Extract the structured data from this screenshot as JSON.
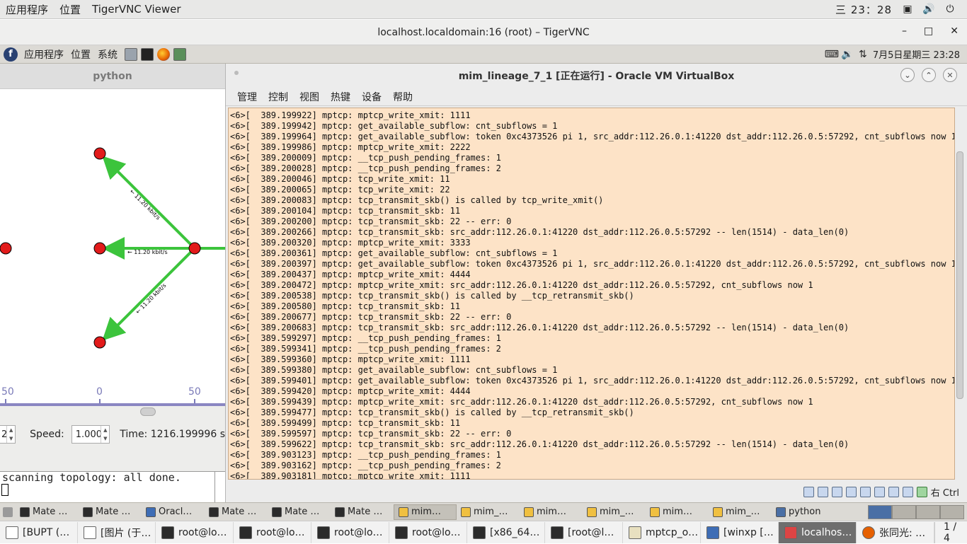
{
  "outer_top": {
    "apps_label": "应用程序",
    "places_label": "位置",
    "app_name": "TigerVNC Viewer",
    "clock": "三 23：28"
  },
  "vnc_window": {
    "title": "localhost.localdomain:16 (root) – TigerVNC",
    "minimize": "–",
    "maximize": "□",
    "close": "✕"
  },
  "inner_panel": {
    "apps_label": "应用程序",
    "places_label": "位置",
    "system_label": "系统",
    "datetime": "7月5日星期三 23:28"
  },
  "python_window": {
    "title": "python",
    "axis_labels": [
      "50",
      "0",
      "50"
    ],
    "links": [
      {
        "label": "← 11.20 kbit/s"
      },
      {
        "label": "← 11.20 kbit/s"
      },
      {
        "label": "← 11.20 kbit/s"
      }
    ],
    "speed_label": "Speed:",
    "speed_value": "1.000",
    "time_text": "Time: 1216.199996 s",
    "left_spin_value": "2"
  },
  "terminal": {
    "line": "scanning topology: all done."
  },
  "vbox": {
    "title": "mim_lineage_7_1 [正在运行] - Oracle VM VirtualBox",
    "menu": [
      "管理",
      "控制",
      "视图",
      "热键",
      "设备",
      "帮助"
    ],
    "host_key": "右 Ctrl",
    "console_lines": [
      "<6>[  389.199922] mptcp: mptcp_write_xmit: 1111",
      "<6>[  389.199942] mptcp: get_available_subflow: cnt_subflows = 1",
      "<6>[  389.199964] mptcp: get_available_subflow: token 0xc4373526 pi 1, src_addr:112.26.0.1:41220 dst_addr:112.26.0.5:57292, cnt_subflows now 1",
      "<6>[  389.199986] mptcp: mptcp_write_xmit: 2222",
      "<6>[  389.200009] mptcp: __tcp_push_pending_frames: 1",
      "<6>[  389.200028] mptcp: __tcp_push_pending_frames: 2",
      "<6>[  389.200046] mptcp: tcp_write_xmit: 11",
      "<6>[  389.200065] mptcp: tcp_write_xmit: 22",
      "<6>[  389.200083] mptcp: tcp_transmit_skb() is called by tcp_write_xmit()",
      "<6>[  389.200104] mptcp: tcp_transmit_skb: 11",
      "<6>[  389.200200] mptcp: tcp_transmit_skb: 22 -- err: 0",
      "<6>[  389.200266] mptcp: tcp_transmit_skb: src_addr:112.26.0.1:41220 dst_addr:112.26.0.5:57292 -- len(1514) - data_len(0)",
      "<6>[  389.200320] mptcp: mptcp_write_xmit: 3333",
      "<6>[  389.200361] mptcp: get_available_subflow: cnt_subflows = 1",
      "<6>[  389.200397] mptcp: get_available_subflow: token 0xc4373526 pi 1, src_addr:112.26.0.1:41220 dst_addr:112.26.0.5:57292, cnt_subflows now 1",
      "<6>[  389.200437] mptcp: mptcp_write_xmit: 4444",
      "<6>[  389.200472] mptcp: mptcp_write_xmit: src_addr:112.26.0.1:41220 dst_addr:112.26.0.5:57292, cnt_subflows now 1",
      "<6>[  389.200538] mptcp: tcp_transmit_skb() is called by __tcp_retransmit_skb()",
      "<6>[  389.200580] mptcp: tcp_transmit_skb: 11",
      "<6>[  389.200677] mptcp: tcp_transmit_skb: 22 -- err: 0",
      "<6>[  389.200683] mptcp: tcp_transmit_skb: src_addr:112.26.0.1:41220 dst_addr:112.26.0.5:57292 -- len(1514) - data_len(0)",
      "<6>[  389.599297] mptcp: __tcp_push_pending_frames: 1",
      "<6>[  389.599341] mptcp: __tcp_push_pending_frames: 2",
      "<6>[  389.599360] mptcp: mptcp_write_xmit: 1111",
      "<6>[  389.599380] mptcp: get_available_subflow: cnt_subflows = 1",
      "<6>[  389.599401] mptcp: get_available_subflow: token 0xc4373526 pi 1, src_addr:112.26.0.1:41220 dst_addr:112.26.0.5:57292, cnt_subflows now 1",
      "<6>[  389.599420] mptcp: mptcp_write_xmit: 4444",
      "<6>[  389.599439] mptcp: mptcp_write_xmit: src_addr:112.26.0.1:41220 dst_addr:112.26.0.5:57292, cnt_subflows now 1",
      "<6>[  389.599477] mptcp: tcp_transmit_skb() is called by __tcp_retransmit_skb()",
      "<6>[  389.599499] mptcp: tcp_transmit_skb: 11",
      "<6>[  389.599597] mptcp: tcp_transmit_skb: 22 -- err: 0",
      "<6>[  389.599622] mptcp: tcp_transmit_skb: src_addr:112.26.0.1:41220 dst_addr:112.26.0.5:57292 -- len(1514) - data_len(0)",
      "<6>[  389.903123] mptcp: __tcp_push_pending_frames: 1",
      "<6>[  389.903162] mptcp: __tcp_push_pending_frames: 2",
      "<6>[  389.903181] mptcp: mptcp_write_xmit: 1111"
    ]
  },
  "inner_taskbar": {
    "items": [
      {
        "label": "Mate …",
        "icon": "terminal-icon"
      },
      {
        "label": "Mate …",
        "icon": "terminal-icon"
      },
      {
        "label": "Oracl…",
        "icon": "virtualbox-icon"
      },
      {
        "label": "Mate …",
        "icon": "terminal-icon"
      },
      {
        "label": "Mate …",
        "icon": "terminal-icon"
      },
      {
        "label": "Mate …",
        "icon": "terminal-icon"
      },
      {
        "label": "mim…",
        "icon": "vm-window-icon",
        "active": true
      },
      {
        "label": "mim_…",
        "icon": "vm-window-icon"
      },
      {
        "label": "mim…",
        "icon": "vm-window-icon"
      },
      {
        "label": "mim_…",
        "icon": "vm-window-icon"
      },
      {
        "label": "mim…",
        "icon": "vm-window-icon"
      },
      {
        "label": "mim_…",
        "icon": "vm-window-icon"
      },
      {
        "label": "python",
        "icon": "window-icon"
      }
    ]
  },
  "outer_taskbar": {
    "items": [
      {
        "label": "[BUPT (…",
        "icon": "document-icon"
      },
      {
        "label": "[图片 (于…",
        "icon": "document-icon"
      },
      {
        "label": "root@lo…",
        "icon": "terminal-icon"
      },
      {
        "label": "root@lo…",
        "icon": "terminal-icon"
      },
      {
        "label": "root@lo…",
        "icon": "terminal-icon"
      },
      {
        "label": "root@lo…",
        "icon": "terminal-icon"
      },
      {
        "label": "[x86_64…",
        "icon": "terminal-icon"
      },
      {
        "label": "[root@l…",
        "icon": "terminal-icon"
      },
      {
        "label": "mptcp_o…",
        "icon": "text-editor-icon"
      },
      {
        "label": "[winxp […",
        "icon": "virtualbox-icon"
      },
      {
        "label": "localhos…",
        "icon": "vnc-icon",
        "active": true
      },
      {
        "label": "张同光: …",
        "icon": "firefox-icon"
      }
    ],
    "page": "1 / 4"
  },
  "colors": {
    "console_bg": "#fde3c7",
    "link_green": "#3cc43c",
    "node_red": "#e21b1b",
    "axis_blue": "#7a7ab8"
  }
}
